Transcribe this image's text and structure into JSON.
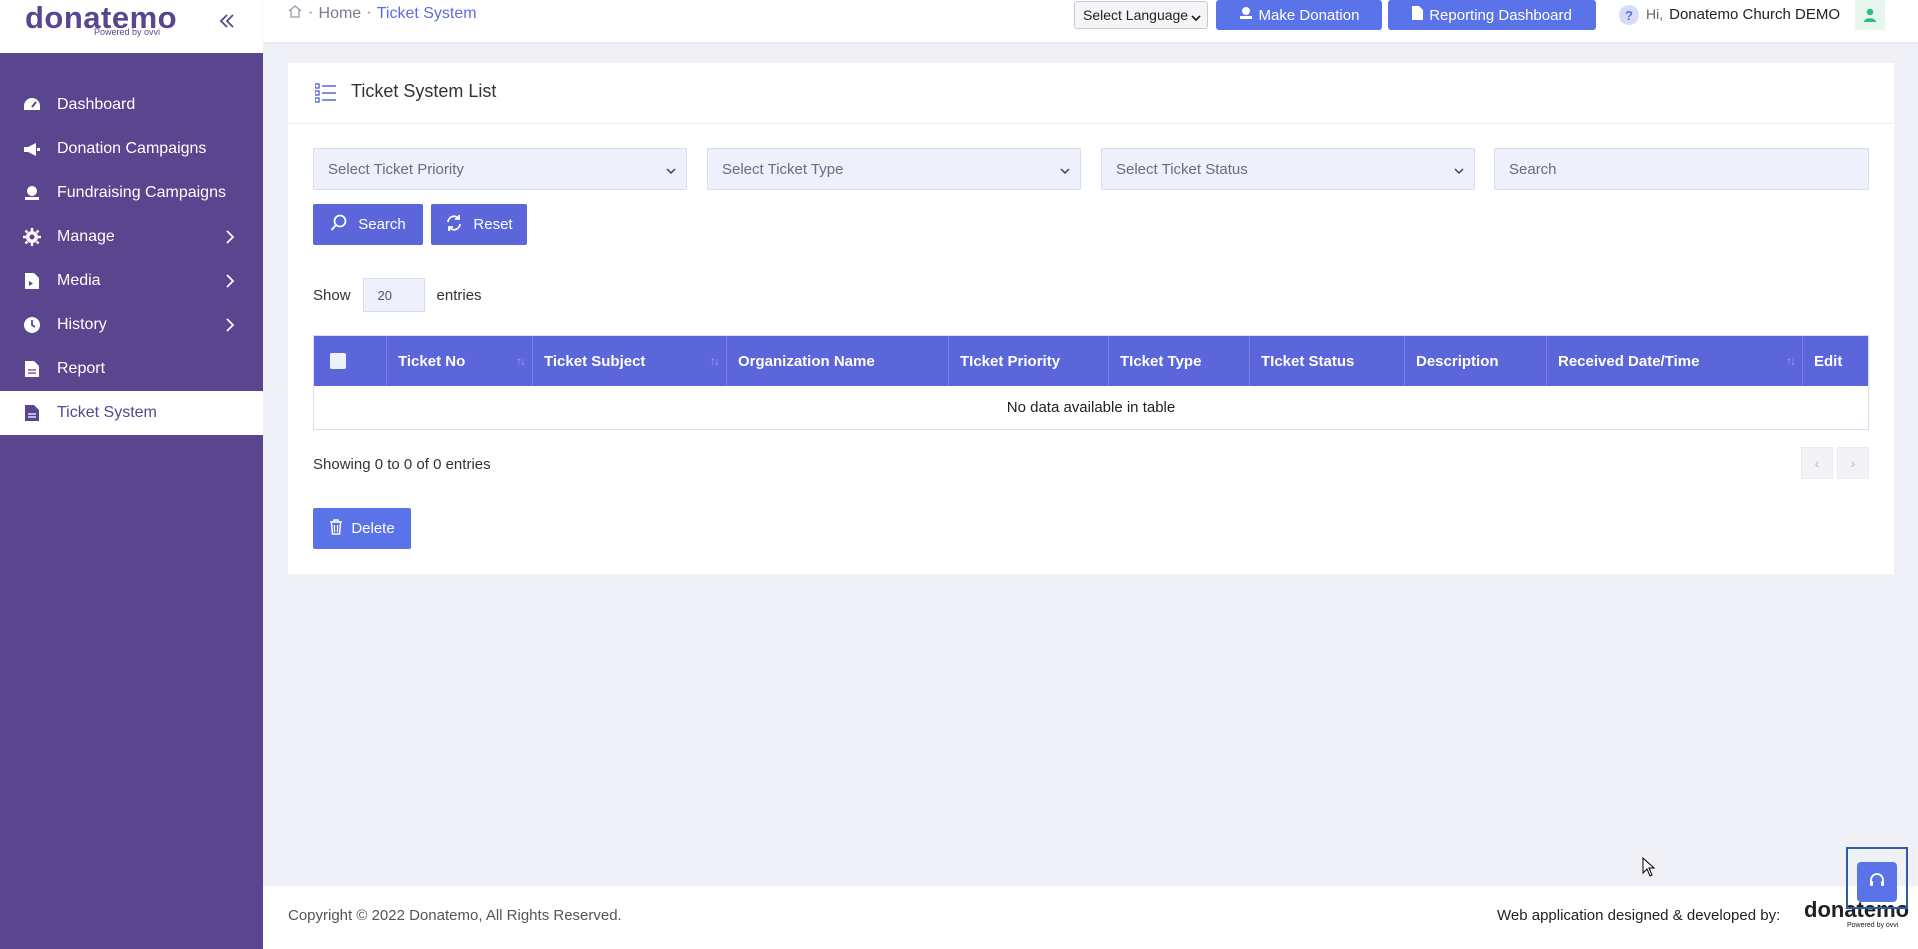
{
  "brand": {
    "logo_text": "donatemo",
    "logo_sub": "Powered by ovvi",
    "accent": "#5b73e8",
    "sidebar_bg": "#5a458f"
  },
  "sidebar": {
    "items": [
      {
        "label": "Dashboard",
        "icon": "dashboard-icon"
      },
      {
        "label": "Donation Campaigns",
        "icon": "megaphone-icon"
      },
      {
        "label": "Fundraising Campaigns",
        "icon": "fundraising-icon"
      },
      {
        "label": "Manage",
        "icon": "gear-icon"
      },
      {
        "label": "Media",
        "icon": "file-media-icon"
      },
      {
        "label": "History",
        "icon": "clock-icon"
      },
      {
        "label": "Report",
        "icon": "document-icon"
      },
      {
        "label": "Ticket System",
        "icon": "document-icon"
      }
    ]
  },
  "header": {
    "breadcrumb": {
      "home": "Home",
      "current": "Ticket System"
    },
    "language_select": "Select Language",
    "make_donation": "Make Donation",
    "reporting_dashboard": "Reporting Dashboard",
    "help": "?",
    "greeting": "Hi,",
    "user_name": "Donatemo Church DEMO"
  },
  "card": {
    "title": "Ticket System List",
    "filters": {
      "priority": "Select Ticket Priority",
      "type": "Select Ticket Type",
      "status": "Select Ticket Status",
      "search_placeholder": "Search"
    },
    "search_button": "Search",
    "reset_button": "Reset",
    "show_label": "Show",
    "entries_value": "20",
    "entries_label": "entries",
    "columns": [
      "Ticket No",
      "Ticket Subject",
      "Organization Name",
      "TIcket Priority",
      "TIcket Type",
      "TIcket Status",
      "Description",
      "Received Date/Time",
      "Edit"
    ],
    "empty_message": "No data available in table",
    "showing_text": "Showing 0 to 0 of 0 entries",
    "prev": "‹",
    "next": "›",
    "delete_button": "Delete"
  },
  "footer": {
    "copyright": "Copyright © 2022 Donatemo, All Rights Reserved.",
    "developed_by": "Web application designed & developed by:",
    "dev_logo": "donatemo",
    "dev_logo_sub": "Powered by ovvi"
  }
}
